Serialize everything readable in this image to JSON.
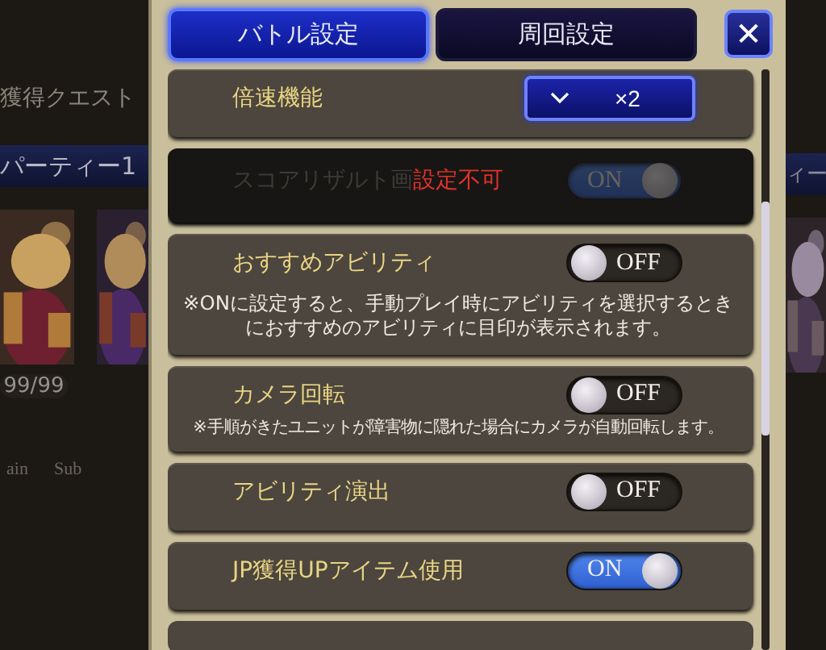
{
  "background": {
    "left": {
      "quest_title": "獲得クエスト",
      "party_label": "パーティー1",
      "level": "99/99",
      "slot_labels": [
        "ain",
        "Sub"
      ]
    },
    "right": {
      "party_label": "ィー"
    }
  },
  "tabs": [
    {
      "label": "バトル設定",
      "selected": true
    },
    {
      "label": "周回設定",
      "selected": false
    }
  ],
  "close_button": {
    "label": "✕"
  },
  "settings": [
    {
      "kind": "select",
      "label": "倍速機能",
      "value": "×2",
      "disabled": false
    },
    {
      "kind": "toggle",
      "label": "スコアリザルト画",
      "notice": "設定不可",
      "on": true,
      "state_label": "ON",
      "disabled": true
    },
    {
      "kind": "toggle",
      "label": "おすすめアビリティ",
      "on": false,
      "state_label": "OFF",
      "disabled": false,
      "note": "※ONに設定すると、手動プレイ時にアビリティを選択するときにおすすめのアビリティに目印が表示されます。"
    },
    {
      "kind": "toggle",
      "label": "カメラ回転",
      "on": false,
      "state_label": "OFF",
      "disabled": false,
      "note": "※手順がきたユニットが障害物に隠れた場合にカメラが自動回転します。"
    },
    {
      "kind": "toggle",
      "label": "アビリティ演出",
      "on": false,
      "state_label": "OFF",
      "disabled": false
    },
    {
      "kind": "toggle",
      "label": "JP獲得UPアイテム使用",
      "on": true,
      "state_label": "ON",
      "disabled": false
    }
  ]
}
